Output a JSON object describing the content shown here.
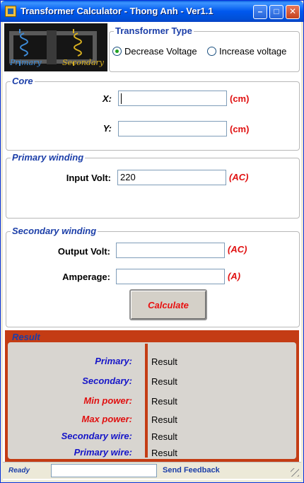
{
  "window": {
    "title": "Transformer Calculator - Thong Anh - Ver1.1",
    "minimize_glyph": "–",
    "maximize_glyph": "□",
    "close_glyph": "✕"
  },
  "banner": {
    "primary_label": "Primary",
    "secondary_label": "Secondary"
  },
  "transformer_type": {
    "legend": "Transformer Type",
    "options": [
      {
        "label": "Decrease Voltage",
        "selected": true
      },
      {
        "label": "Increase voltage",
        "selected": false
      }
    ]
  },
  "core": {
    "legend": "Core",
    "x_label": "X:",
    "x_value": "",
    "x_unit": "(cm)",
    "y_label": "Y:",
    "y_value": "",
    "y_unit": "(cm)"
  },
  "primary_winding": {
    "legend": "Primary winding",
    "input_volt_label": "Input Volt:",
    "input_volt_value": "220",
    "input_volt_unit": "(AC)"
  },
  "secondary_winding": {
    "legend": "Secondary winding",
    "output_volt_label": "Output Volt:",
    "output_volt_value": "",
    "output_volt_unit": "(AC)",
    "amperage_label": "Amperage:",
    "amperage_value": "",
    "amperage_unit": "(A)"
  },
  "calculate_label": "Calculate",
  "result": {
    "legend": "Result",
    "rows": [
      {
        "label": "Primary:",
        "value": "Result"
      },
      {
        "label": "Secondary:",
        "value": "Result"
      },
      {
        "label": "Min power:",
        "value": "Result"
      },
      {
        "label": "Max power:",
        "value": "Result"
      },
      {
        "label": "Secondary wire:",
        "value": "Result"
      },
      {
        "label": "Primary wire:",
        "value": "Result"
      }
    ]
  },
  "status": {
    "ready": "Ready",
    "feedback_link": "Send Feedback"
  },
  "colors": {
    "title_bar": "#0058ee",
    "legend_blue": "#1b3ea8",
    "unit_red": "#e01010",
    "result_frame": "#c43c14",
    "label_blue": "#1515c8"
  }
}
